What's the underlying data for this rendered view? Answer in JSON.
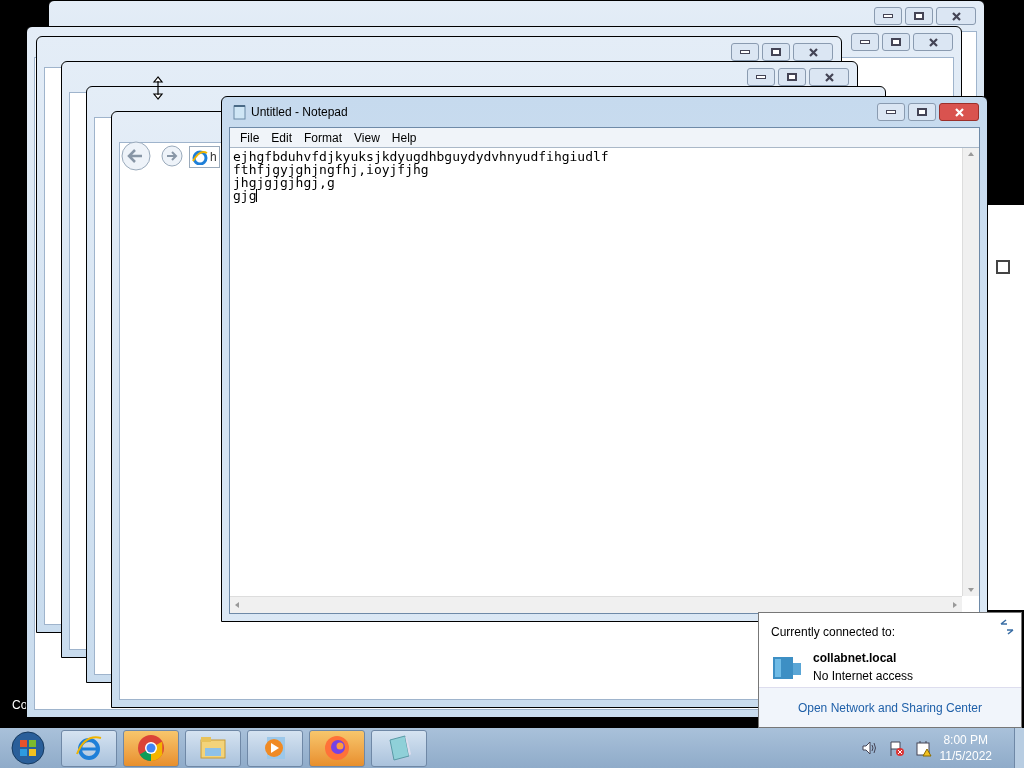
{
  "desktop": {
    "label_fragment": "Co"
  },
  "browser": {
    "address_fragment": "h"
  },
  "notepad": {
    "title": "Untitled - Notepad",
    "menu": [
      "File",
      "Edit",
      "Format",
      "View",
      "Help"
    ],
    "lines": [
      "ejhgfbduhvfdjkyuksjkdyugdhbguydydvhnyudfihgiudlf",
      "fthfjgyjghjngfhj,ioyjfjhg",
      "jhgjgjgjhgj,g",
      "gjg"
    ]
  },
  "network_popup": {
    "heading": "Currently connected to:",
    "network_name": "collabnet.local",
    "network_status": "No Internet access",
    "link": "Open Network and Sharing Center"
  },
  "taskbar": {
    "apps": [
      {
        "kind": "ie",
        "highlighted": false
      },
      {
        "kind": "chrome",
        "highlighted": true
      },
      {
        "kind": "explorer",
        "highlighted": false
      },
      {
        "kind": "media",
        "highlighted": false
      },
      {
        "kind": "firefox",
        "highlighted": true
      },
      {
        "kind": "notepad",
        "highlighted": false
      }
    ],
    "time": "8:00 PM",
    "date": "11/5/2022"
  }
}
